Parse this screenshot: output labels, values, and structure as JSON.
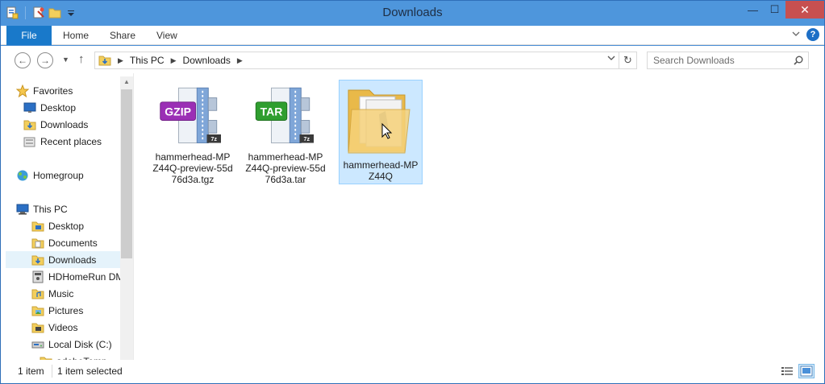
{
  "window": {
    "title": "Downloads",
    "controls": {
      "minimize": "—",
      "maximize": "☐",
      "close": "✕"
    }
  },
  "quick_access": {
    "icons": [
      "properties-icon",
      "new-folder-icon",
      "folder-icon",
      "customize-dropdown-icon"
    ]
  },
  "ribbon": {
    "tabs": [
      {
        "label": "File"
      },
      {
        "label": "Home"
      },
      {
        "label": "Share"
      },
      {
        "label": "View"
      }
    ],
    "help": "?"
  },
  "navigation": {
    "back": "←",
    "forward": "→",
    "up": "↑",
    "breadcrumb": [
      "This PC",
      "Downloads"
    ],
    "search_placeholder": "Search Downloads"
  },
  "sidebar": {
    "items": [
      {
        "label": "Favorites",
        "icon": "star-icon",
        "level": 0
      },
      {
        "label": "Desktop",
        "icon": "desktop-icon",
        "level": 1
      },
      {
        "label": "Downloads",
        "icon": "downloads-icon",
        "level": 1
      },
      {
        "label": "Recent places",
        "icon": "recent-places-icon",
        "level": 1
      },
      {
        "label": "Homegroup",
        "icon": "homegroup-icon",
        "level": 0
      },
      {
        "label": "This PC",
        "icon": "computer-icon",
        "level": 0
      },
      {
        "label": "Desktop",
        "icon": "desktop-icon",
        "level": 2
      },
      {
        "label": "Documents",
        "icon": "documents-icon",
        "level": 2
      },
      {
        "label": "Downloads",
        "icon": "downloads-icon",
        "level": 2,
        "selected": true
      },
      {
        "label": "HDHomeRun DMR",
        "icon": "media-server-icon",
        "level": 2
      },
      {
        "label": "Music",
        "icon": "music-icon",
        "level": 2
      },
      {
        "label": "Pictures",
        "icon": "pictures-icon",
        "level": 2
      },
      {
        "label": "Videos",
        "icon": "videos-icon",
        "level": 2
      },
      {
        "label": "Local Disk (C:)",
        "icon": "drive-icon",
        "level": 2
      },
      {
        "label": "adobeTemp",
        "icon": "folder-icon",
        "level": 3
      }
    ]
  },
  "files": [
    {
      "name": "hammerhead-MPZ44Q-preview-55d76d3a.tgz",
      "badge": "GZIP",
      "badge_color": "#9b2fb5",
      "icon": "gzip-archive-icon",
      "selected": false
    },
    {
      "name": "hammerhead-MPZ44Q-preview-55d76d3a.tar",
      "badge": "TAR",
      "badge_color": "#2f9e2f",
      "icon": "tar-archive-icon",
      "selected": false
    },
    {
      "name": "hammerhead-MPZ44Q",
      "icon": "folder-icon",
      "selected": true
    }
  ],
  "status": {
    "count": "1 item",
    "selection": "1 item selected"
  },
  "colors": {
    "title_bar": "#4e96dc",
    "file_tab": "#1979ca",
    "selection": "#cce8ff",
    "close_button": "#c75050"
  }
}
